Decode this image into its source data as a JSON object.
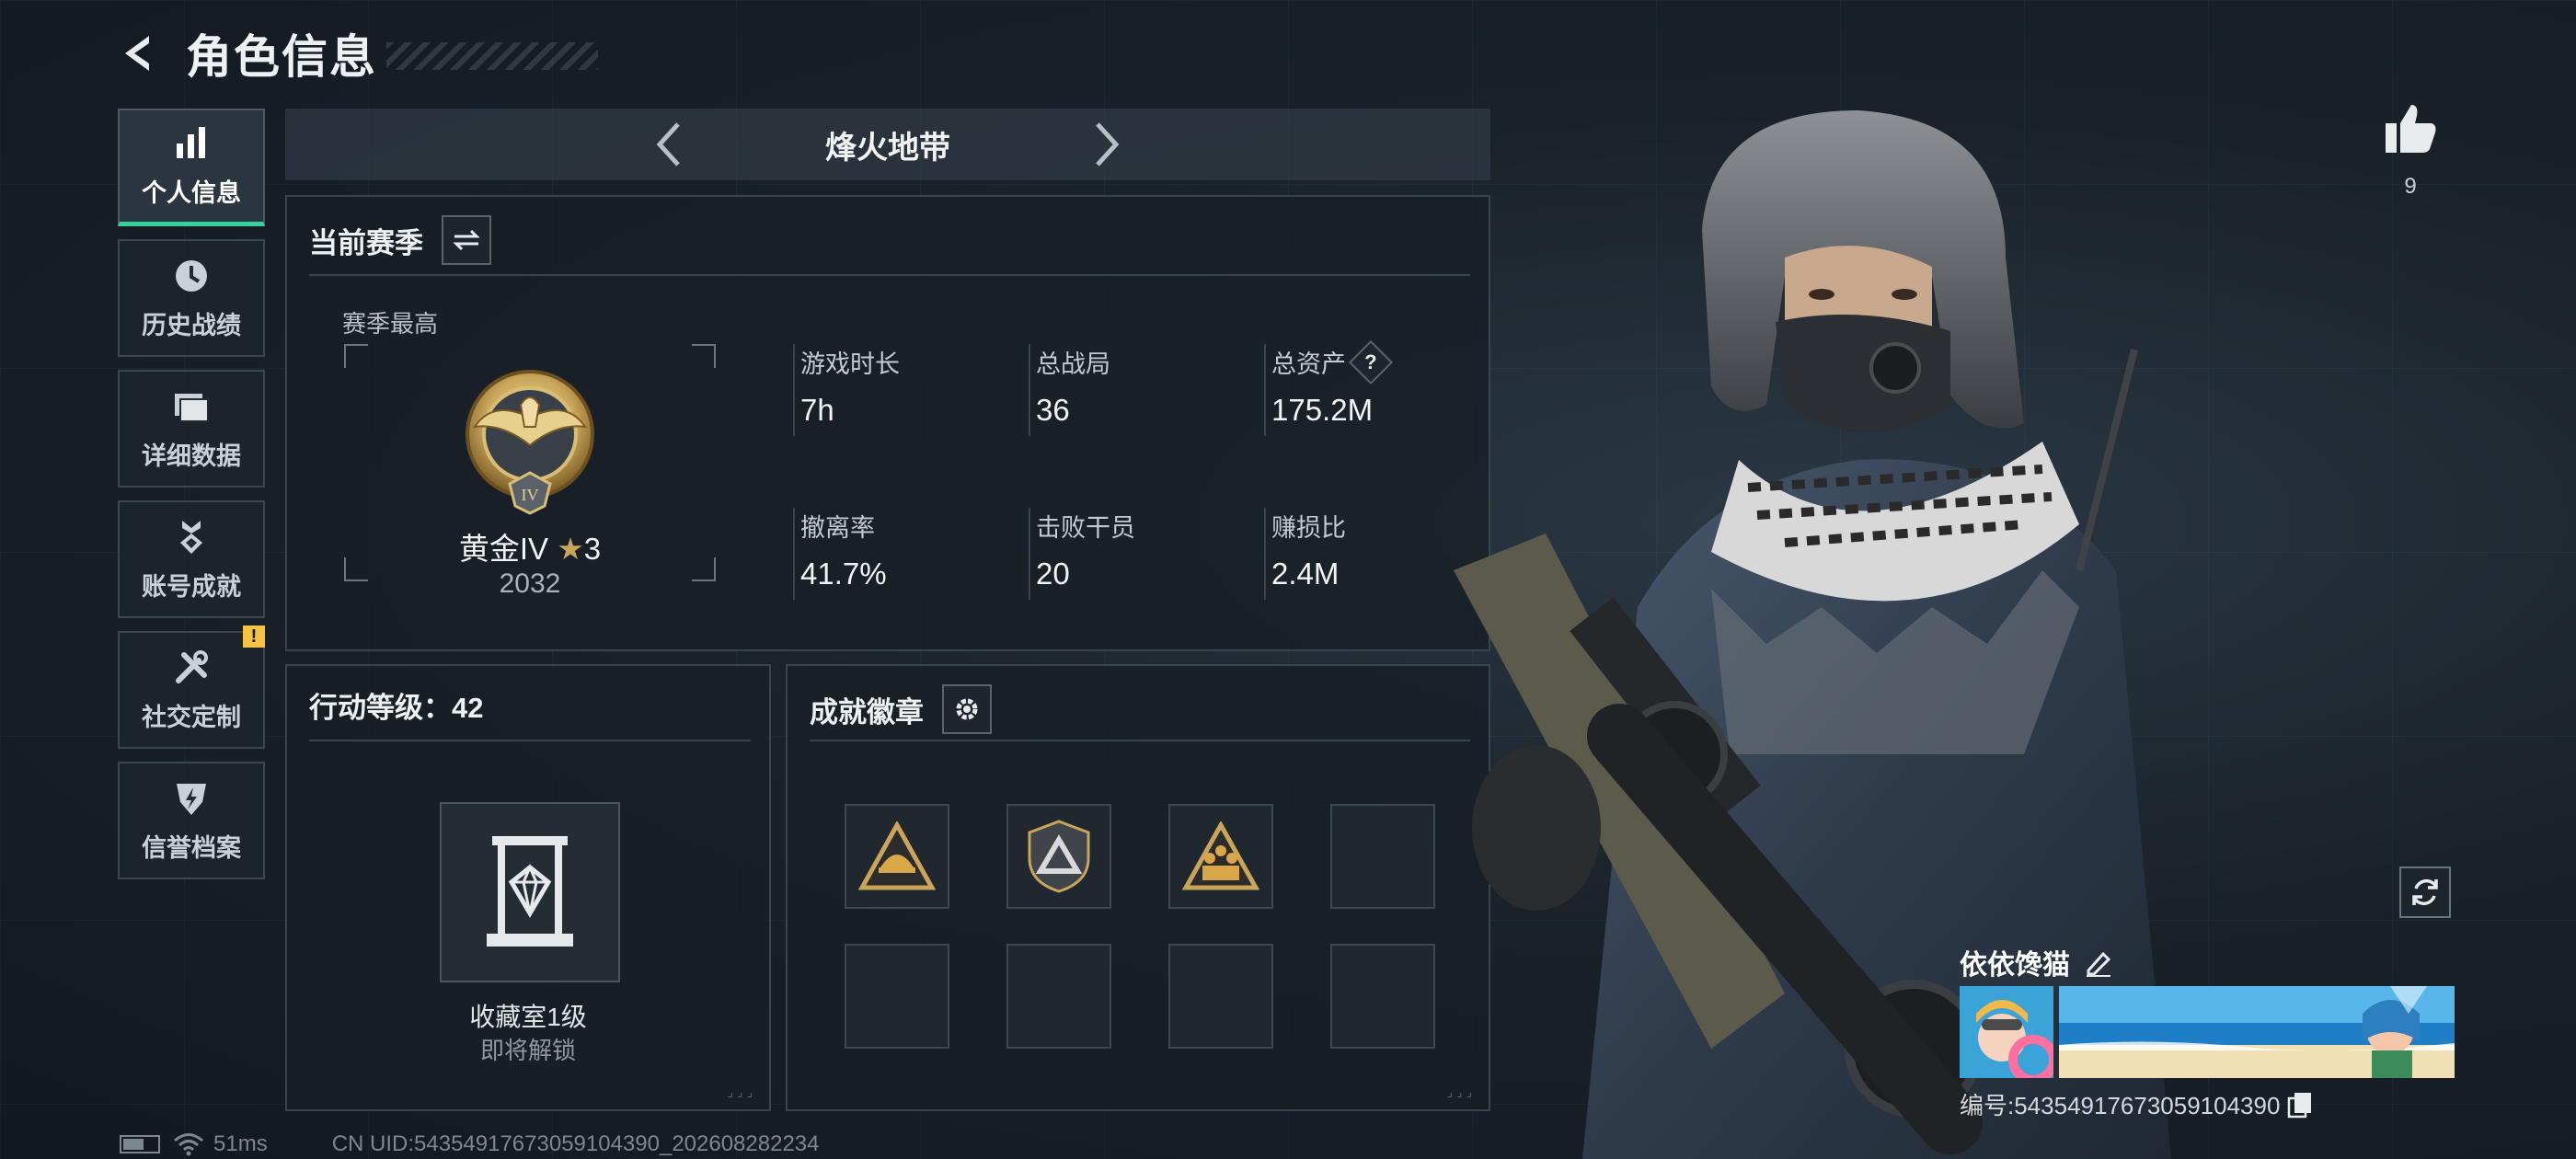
{
  "header": {
    "title": "角色信息"
  },
  "sidebar": {
    "items": [
      {
        "label": "个人信息",
        "active": true,
        "icon": "bar-chart-icon"
      },
      {
        "label": "历史战绩",
        "active": false,
        "icon": "clock-icon"
      },
      {
        "label": "详细数据",
        "active": false,
        "icon": "folder-icon"
      },
      {
        "label": "账号成就",
        "active": false,
        "icon": "medal-icon"
      },
      {
        "label": "社交定制",
        "active": false,
        "icon": "tools-icon",
        "badge": "!"
      },
      {
        "label": "信誉档案",
        "active": false,
        "icon": "shield-icon"
      }
    ]
  },
  "mode": {
    "title": "烽火地带"
  },
  "season": {
    "title": "当前赛季",
    "best_label": "赛季最高",
    "rank_name": "黄金IV",
    "rank_stars": "3",
    "rank_score": "2032",
    "stats": [
      {
        "label": "游戏时长",
        "value": "7h"
      },
      {
        "label": "总战局",
        "value": "36"
      },
      {
        "label": "总资产",
        "value": "175.2M",
        "help": "?"
      },
      {
        "label": "撤离率",
        "value": "41.7%"
      },
      {
        "label": "击败干员",
        "value": "20"
      },
      {
        "label": "赚损比",
        "value": "2.4M"
      }
    ]
  },
  "level": {
    "title": "行动等级：42",
    "collection_name": "收藏室1级",
    "collection_status": "即将解锁"
  },
  "badges": {
    "title": "成就徽章",
    "slots": [
      "badge-helmet-icon",
      "badge-shield-icon",
      "badge-team-icon",
      "",
      "",
      "",
      "",
      ""
    ]
  },
  "likes": {
    "count": "9"
  },
  "player": {
    "name": "依依馋猫",
    "id_text": "编号:5435491767305910439​0"
  },
  "footer": {
    "ping": "51ms",
    "uid": "CN UID:5435491767305910439​0_202608282234"
  },
  "colors": {
    "accent": "#34d399",
    "warning": "#f5c242",
    "gold": "#c8a55a"
  }
}
